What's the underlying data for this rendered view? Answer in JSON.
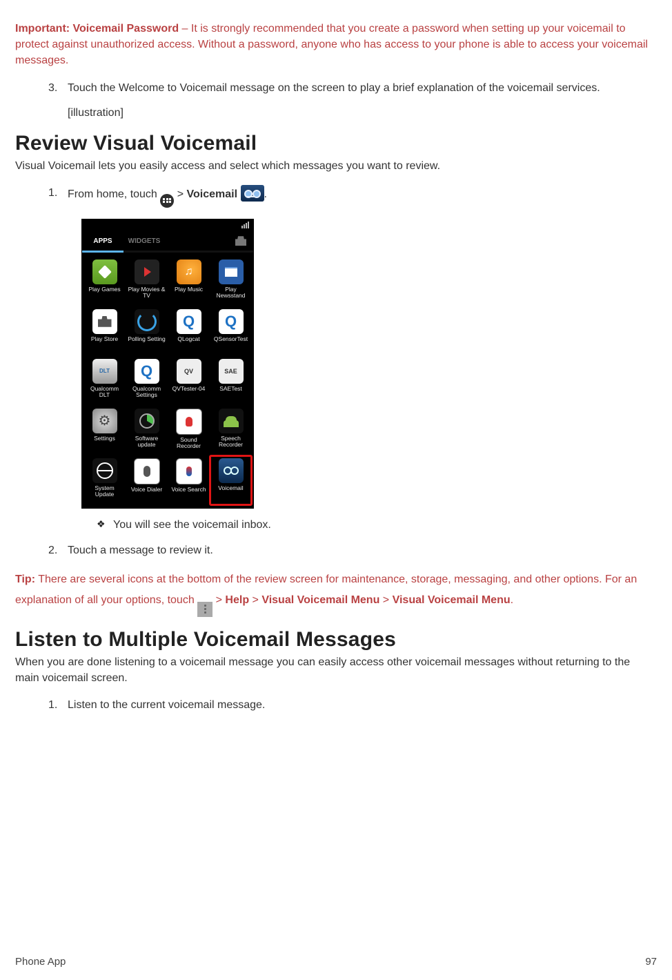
{
  "note_important": {
    "label": "Important: Voicemail Password",
    "sep": " – ",
    "text": "It is strongly recommended that you create a password when setting up your voicemail to protect against unauthorized access. Without a password, anyone who has access to your phone is able to access your voicemail messages."
  },
  "step3": {
    "num": "3.",
    "text": "Touch the Welcome to Voicemail message on the screen to play a brief explanation of the voicemail services.",
    "illus": "[illustration]"
  },
  "sec1": {
    "heading": "Review Visual Voicemail",
    "lead": "Visual Voicemail lets you easily access and select which messages you want to review."
  },
  "s1step1": {
    "num": "1.",
    "pre": "From home, touch ",
    "gt": " > ",
    "bold1": "Voicemail",
    "period": "."
  },
  "screenshot": {
    "tab_apps": "APPS",
    "tab_widgets": "WIDGETS",
    "apps": [
      {
        "label": "Play Games",
        "cls": "i-play-games"
      },
      {
        "label": "Play Movies & TV",
        "cls": "i-play-mtv"
      },
      {
        "label": "Play Music",
        "cls": "i-play-music"
      },
      {
        "label": "Play Newsstand",
        "cls": "i-play-news"
      },
      {
        "label": "Play Store",
        "cls": "i-play-store"
      },
      {
        "label": "Polling Setting",
        "cls": "i-spinner"
      },
      {
        "label": "QLogcat",
        "cls": "i-qloc"
      },
      {
        "label": "QSensorTest",
        "cls": "i-qloc"
      },
      {
        "label": "Qualcomm DLT",
        "cls": "i-dlt"
      },
      {
        "label": "Qualcomm Settings",
        "cls": "i-qloc"
      },
      {
        "label": "QVTester-04",
        "cls": "i-text",
        "txt": "QV"
      },
      {
        "label": "SAETest",
        "cls": "i-text",
        "txt": "SAE"
      },
      {
        "label": "Settings",
        "cls": "i-gear"
      },
      {
        "label": "Software update",
        "cls": "i-sw"
      },
      {
        "label": "Sound Recorder",
        "cls": "i-sound"
      },
      {
        "label": "Speech Recorder",
        "cls": "i-android"
      },
      {
        "label": "System Update",
        "cls": "i-sysupd"
      },
      {
        "label": "Voice Dialer",
        "cls": "i-vdial"
      },
      {
        "label": "Voice Search",
        "cls": "i-vsearch"
      },
      {
        "label": "Voicemail",
        "cls": "i-voicemail",
        "highlight": true
      }
    ]
  },
  "s1bullet": "You will see the voicemail inbox.",
  "s1step2": {
    "num": "2.",
    "text": "Touch a message to review it."
  },
  "tip": {
    "label": "Tip:",
    "t1": " There are several icons at the bottom of the review screen for maintenance, storage, messaging, and other options. For an explanation of all your options, touch ",
    "gt1": " > ",
    "b1": "Help",
    "gt2": " > ",
    "b2": "Visual Voicemail Menu",
    "gt3": " > ",
    "b3": "Visual Voicemail Menu",
    "end": "."
  },
  "sec2": {
    "heading": "Listen to Multiple Voicemail Messages",
    "lead": "When you are done listening to a voicemail message you can easily access other voicemail messages without returning to the main voicemail screen."
  },
  "s2step1": {
    "num": "1.",
    "text": "Listen to the current voicemail message."
  },
  "footer": {
    "left": "Phone App",
    "right": "97"
  }
}
